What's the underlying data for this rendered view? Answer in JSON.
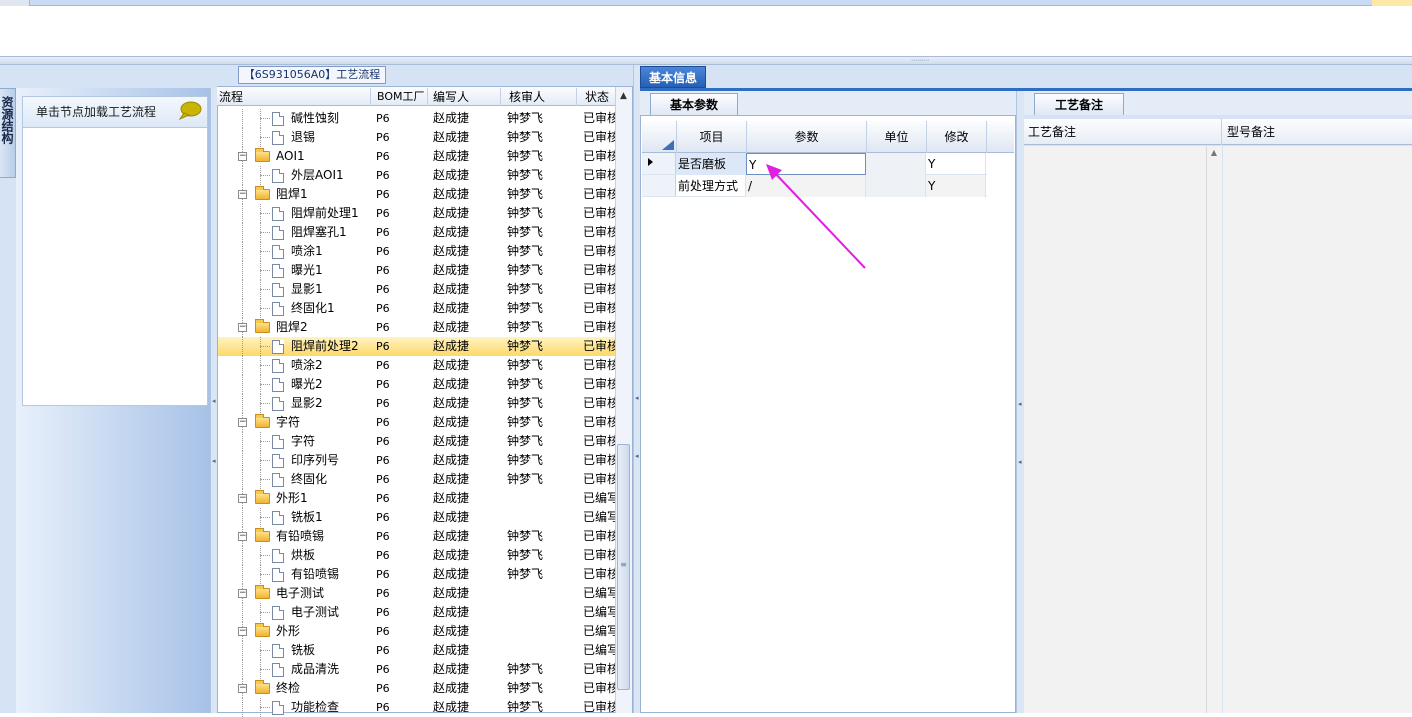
{
  "top": {
    "grip": "⋯⋯⋯"
  },
  "left_nav": {
    "tab_label": "资源结构",
    "tip_text": "单击节点加载工艺流程",
    "icon": "speech-bubble-icon"
  },
  "tree": {
    "caption": "【6S931056A0】工艺流程",
    "columns": [
      "流程",
      "BOM工厂",
      "编写人",
      "核审人",
      "状态"
    ],
    "rows": [
      {
        "name": "碱性蚀刻",
        "level": 2,
        "type": "doc",
        "bom": "P6",
        "author": "赵成捷",
        "checker": "钟梦飞",
        "status": "已审核"
      },
      {
        "name": "退锡",
        "level": 2,
        "type": "doc",
        "bom": "P6",
        "author": "赵成捷",
        "checker": "钟梦飞",
        "status": "已审核"
      },
      {
        "name": "AOI1",
        "level": 1,
        "type": "folder",
        "bom": "P6",
        "author": "赵成捷",
        "checker": "钟梦飞",
        "status": "已审核"
      },
      {
        "name": "外层AOI1",
        "level": 2,
        "type": "doc",
        "bom": "P6",
        "author": "赵成捷",
        "checker": "钟梦飞",
        "status": "已审核"
      },
      {
        "name": "阻焊1",
        "level": 1,
        "type": "folder",
        "bom": "P6",
        "author": "赵成捷",
        "checker": "钟梦飞",
        "status": "已审核"
      },
      {
        "name": "阻焊前处理1",
        "level": 2,
        "type": "doc",
        "bom": "P6",
        "author": "赵成捷",
        "checker": "钟梦飞",
        "status": "已审核"
      },
      {
        "name": "阻焊塞孔1",
        "level": 2,
        "type": "doc",
        "bom": "P6",
        "author": "赵成捷",
        "checker": "钟梦飞",
        "status": "已审核"
      },
      {
        "name": "喷涂1",
        "level": 2,
        "type": "doc",
        "bom": "P6",
        "author": "赵成捷",
        "checker": "钟梦飞",
        "status": "已审核"
      },
      {
        "name": "曝光1",
        "level": 2,
        "type": "doc",
        "bom": "P6",
        "author": "赵成捷",
        "checker": "钟梦飞",
        "status": "已审核"
      },
      {
        "name": "显影1",
        "level": 2,
        "type": "doc",
        "bom": "P6",
        "author": "赵成捷",
        "checker": "钟梦飞",
        "status": "已审核"
      },
      {
        "name": "终固化1",
        "level": 2,
        "type": "doc",
        "bom": "P6",
        "author": "赵成捷",
        "checker": "钟梦飞",
        "status": "已审核"
      },
      {
        "name": "阻焊2",
        "level": 1,
        "type": "folder",
        "bom": "P6",
        "author": "赵成捷",
        "checker": "钟梦飞",
        "status": "已审核"
      },
      {
        "name": "阻焊前处理2",
        "level": 2,
        "type": "doc",
        "bom": "P6",
        "author": "赵成捷",
        "checker": "钟梦飞",
        "status": "已审核",
        "selected": true
      },
      {
        "name": "喷涂2",
        "level": 2,
        "type": "doc",
        "bom": "P6",
        "author": "赵成捷",
        "checker": "钟梦飞",
        "status": "已审核"
      },
      {
        "name": "曝光2",
        "level": 2,
        "type": "doc",
        "bom": "P6",
        "author": "赵成捷",
        "checker": "钟梦飞",
        "status": "已审核"
      },
      {
        "name": "显影2",
        "level": 2,
        "type": "doc",
        "bom": "P6",
        "author": "赵成捷",
        "checker": "钟梦飞",
        "status": "已审核"
      },
      {
        "name": "字符",
        "level": 1,
        "type": "folder",
        "bom": "P6",
        "author": "赵成捷",
        "checker": "钟梦飞",
        "status": "已审核"
      },
      {
        "name": "字符",
        "level": 2,
        "type": "doc",
        "bom": "P6",
        "author": "赵成捷",
        "checker": "钟梦飞",
        "status": "已审核"
      },
      {
        "name": "印序列号",
        "level": 2,
        "type": "doc",
        "bom": "P6",
        "author": "赵成捷",
        "checker": "钟梦飞",
        "status": "已审核"
      },
      {
        "name": "终固化",
        "level": 2,
        "type": "doc",
        "bom": "P6",
        "author": "赵成捷",
        "checker": "钟梦飞",
        "status": "已审核"
      },
      {
        "name": "外形1",
        "level": 1,
        "type": "folder",
        "bom": "P6",
        "author": "赵成捷",
        "checker": "",
        "status": "已编写"
      },
      {
        "name": "铣板1",
        "level": 2,
        "type": "doc",
        "bom": "P6",
        "author": "赵成捷",
        "checker": "",
        "status": "已编写"
      },
      {
        "name": "有铅喷锡",
        "level": 1,
        "type": "folder",
        "bom": "P6",
        "author": "赵成捷",
        "checker": "钟梦飞",
        "status": "已审核"
      },
      {
        "name": "烘板",
        "level": 2,
        "type": "doc",
        "bom": "P6",
        "author": "赵成捷",
        "checker": "钟梦飞",
        "status": "已审核"
      },
      {
        "name": "有铅喷锡",
        "level": 2,
        "type": "doc",
        "bom": "P6",
        "author": "赵成捷",
        "checker": "钟梦飞",
        "status": "已审核"
      },
      {
        "name": "电子测试",
        "level": 1,
        "type": "folder",
        "bom": "P6",
        "author": "赵成捷",
        "checker": "",
        "status": "已编写"
      },
      {
        "name": "电子测试",
        "level": 2,
        "type": "doc",
        "bom": "P6",
        "author": "赵成捷",
        "checker": "",
        "status": "已编写"
      },
      {
        "name": "外形",
        "level": 1,
        "type": "folder",
        "bom": "P6",
        "author": "赵成捷",
        "checker": "",
        "status": "已编写"
      },
      {
        "name": "铣板",
        "level": 2,
        "type": "doc",
        "bom": "P6",
        "author": "赵成捷",
        "checker": "",
        "status": "已编写"
      },
      {
        "name": "成品清洗",
        "level": 2,
        "type": "doc",
        "bom": "P6",
        "author": "赵成捷",
        "checker": "钟梦飞",
        "status": "已审核"
      },
      {
        "name": "终检",
        "level": 1,
        "type": "folder",
        "bom": "P6",
        "author": "赵成捷",
        "checker": "钟梦飞",
        "status": "已审核"
      },
      {
        "name": "功能检查",
        "level": 2,
        "type": "doc",
        "bom": "P6",
        "author": "赵成捷",
        "checker": "钟梦飞",
        "status": "已审核"
      }
    ]
  },
  "basic_info": {
    "tab_label": "基本信息",
    "params_tab": "基本参数",
    "columns": [
      "项目",
      "参数",
      "单位",
      "修改"
    ],
    "rows": [
      {
        "item": "是否磨板",
        "param": "Y",
        "unit": "",
        "modify": "Y"
      },
      {
        "item": "前处理方式",
        "param": "/",
        "unit": "",
        "modify": "Y"
      }
    ]
  },
  "notes": {
    "tab_label": "工艺备注",
    "col_process": "工艺备注",
    "col_model": "型号备注"
  },
  "colors": {
    "accent": "#2f6cc3",
    "selection": "#fcd96a",
    "annotation_arrow": "#e020e0"
  }
}
